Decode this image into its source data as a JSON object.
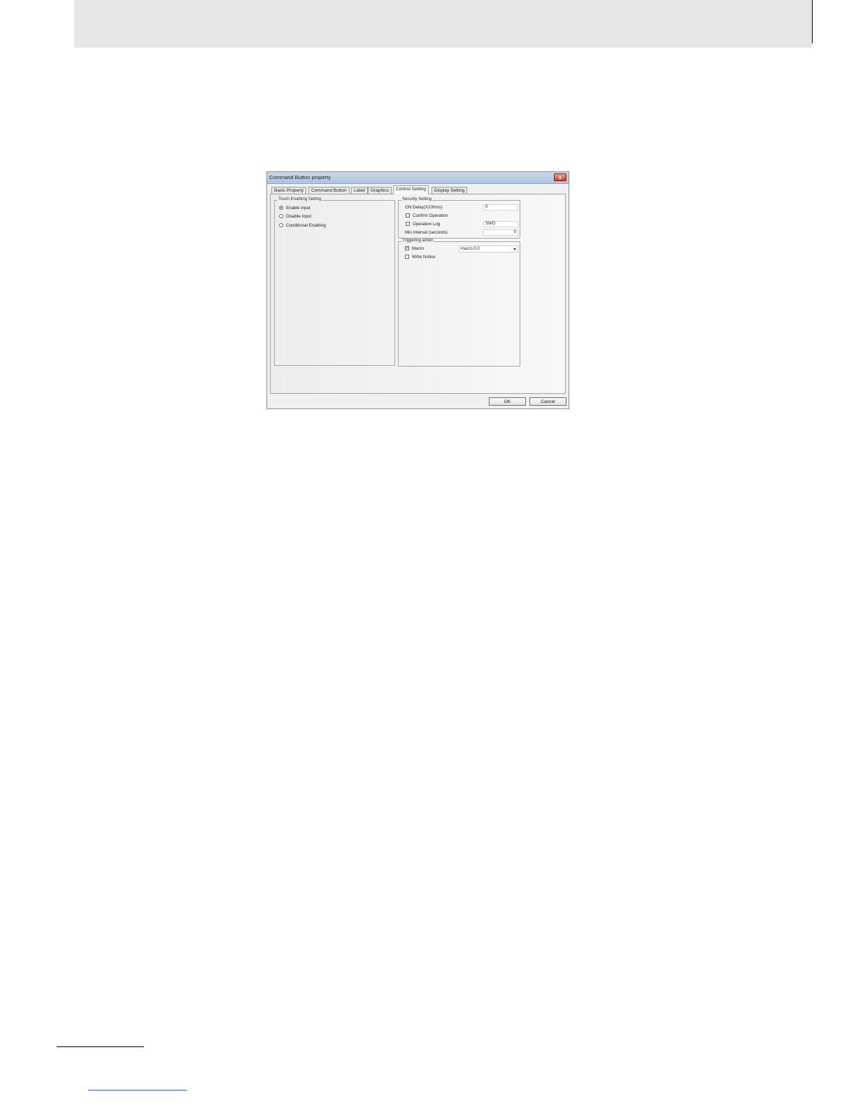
{
  "dialog": {
    "title": "Command Button property",
    "close_glyph": "x",
    "tabs": [
      {
        "label": "Basic Property"
      },
      {
        "label": "Command Button"
      },
      {
        "label": "Label"
      },
      {
        "label": "Graphics"
      },
      {
        "label": "Control Setting"
      },
      {
        "label": "Display Setting"
      }
    ],
    "active_tab": "Control Setting",
    "touch_enabling": {
      "title": "Touch Enabling Setting",
      "options": [
        {
          "label": "Enable Input",
          "selected": true
        },
        {
          "label": "Disable Input",
          "selected": false
        },
        {
          "label": "Conditional Enabling",
          "selected": false
        }
      ]
    },
    "security": {
      "title": "Security Setting",
      "on_delay_label": "ON Delay(X100ms)",
      "on_delay_value": "0",
      "confirm_operation_label": "Confirm Operation",
      "operation_log_label": "Operation Log",
      "operation_log_value": "SWO",
      "min_interval_label": "Min Interval (seconds)",
      "min_interval_value": "0"
    },
    "triggering": {
      "title": "Triggering action",
      "macro_label": "Macro",
      "macro_checked": true,
      "macro_value": "macro,0,0",
      "write_notice_label": "Write Notice",
      "write_notice_checked": false
    },
    "ok_label": "OK",
    "cancel_label": "Cancel"
  }
}
